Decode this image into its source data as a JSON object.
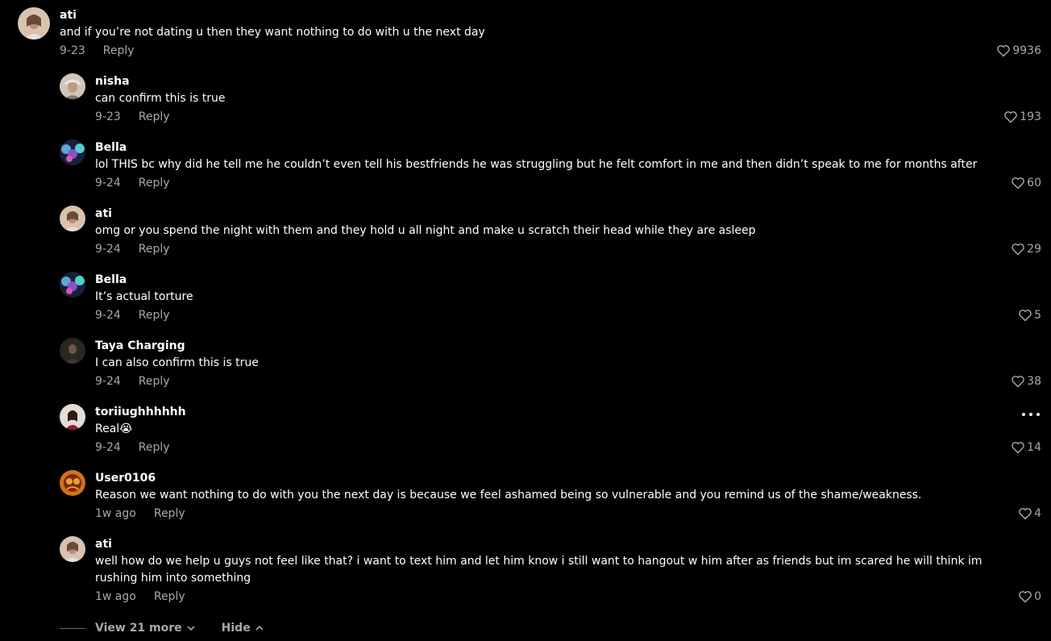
{
  "colors": {
    "background": "#000000",
    "text": "#ffffff",
    "muted": "#a8a8a8"
  },
  "comments": [
    {
      "username": "ati",
      "text": "and if you’re not dating u then they want nothing to do with u the next day",
      "date": "9-23",
      "reply": "Reply",
      "likes": "9936"
    },
    {
      "username": "nisha",
      "text": "can confirm this is true",
      "date": "9-23",
      "reply": "Reply",
      "likes": "193"
    },
    {
      "username": "Bella",
      "text": "lol THIS bc why did he tell me he couldn’t even tell his bestfriends he was struggling but he felt comfort in me and then didn’t speak to me for months after",
      "date": "9-24",
      "reply": "Reply",
      "likes": "60"
    },
    {
      "username": "ati",
      "text": "omg or you spend the night with them and they hold u all night and make u scratch their head while they are asleep",
      "date": "9-24",
      "reply": "Reply",
      "likes": "29"
    },
    {
      "username": "Bella",
      "text": "It’s actual torture",
      "date": "9-24",
      "reply": "Reply",
      "likes": "5"
    },
    {
      "username": "Taya Charging",
      "text": "I can also confirm this is true",
      "date": "9-24",
      "reply": "Reply",
      "likes": "38"
    },
    {
      "username": "toriiughhhhhh",
      "text": "Real😭",
      "date": "9-24",
      "reply": "Reply",
      "likes": "14"
    },
    {
      "username": "User0106",
      "text": "Reason we want nothing to do with you the next day is because we feel ashamed being so vulnerable and you remind us of the shame/weakness.",
      "date": "1w ago",
      "reply": "Reply",
      "likes": "4"
    },
    {
      "username": "ati",
      "text": "well how do we help u guys not feel like that? i want to text him and let him know i still want to hangout w him after as friends but im scared he will think im rushing him into something",
      "date": "1w ago",
      "reply": "Reply",
      "likes": "0"
    }
  ],
  "footer": {
    "view_more": "View 21 more",
    "hide": "Hide"
  }
}
